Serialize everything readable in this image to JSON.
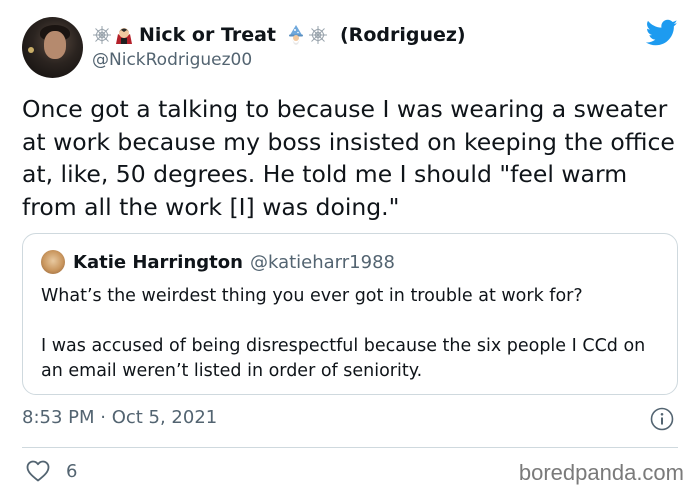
{
  "author": {
    "display_name": "Nick or Treat",
    "display_name_suffix": "(Rodriguez)",
    "handle": "@NickRodriguez00",
    "emojis_left": [
      "spider-web-emoji",
      "vampire-emoji"
    ],
    "emojis_right": [
      "mage-emoji",
      "spider-web-emoji"
    ]
  },
  "tweet": {
    "text": "Once got a talking to because I was wearing a sweater at work because my boss insisted on keeping the office at, like, 50 degrees. He told me I should \"feel warm from all the work [I] was doing.\"",
    "timestamp": "8:53 PM · Oct 5, 2021",
    "like_count": "6"
  },
  "quoted_tweet": {
    "display_name": "Katie Harrington",
    "handle": "@katieharr1988",
    "paragraphs": [
      "What’s the weirdest thing you ever got in trouble at work for?",
      "I was accused of being disrespectful because the six people I CCd on an email weren’t listed in order of seniority."
    ]
  },
  "watermark": "boredpanda.com",
  "colors": {
    "twitter_blue": "#1d9bf0",
    "secondary_text": "#536471",
    "border": "#cfd9de"
  }
}
